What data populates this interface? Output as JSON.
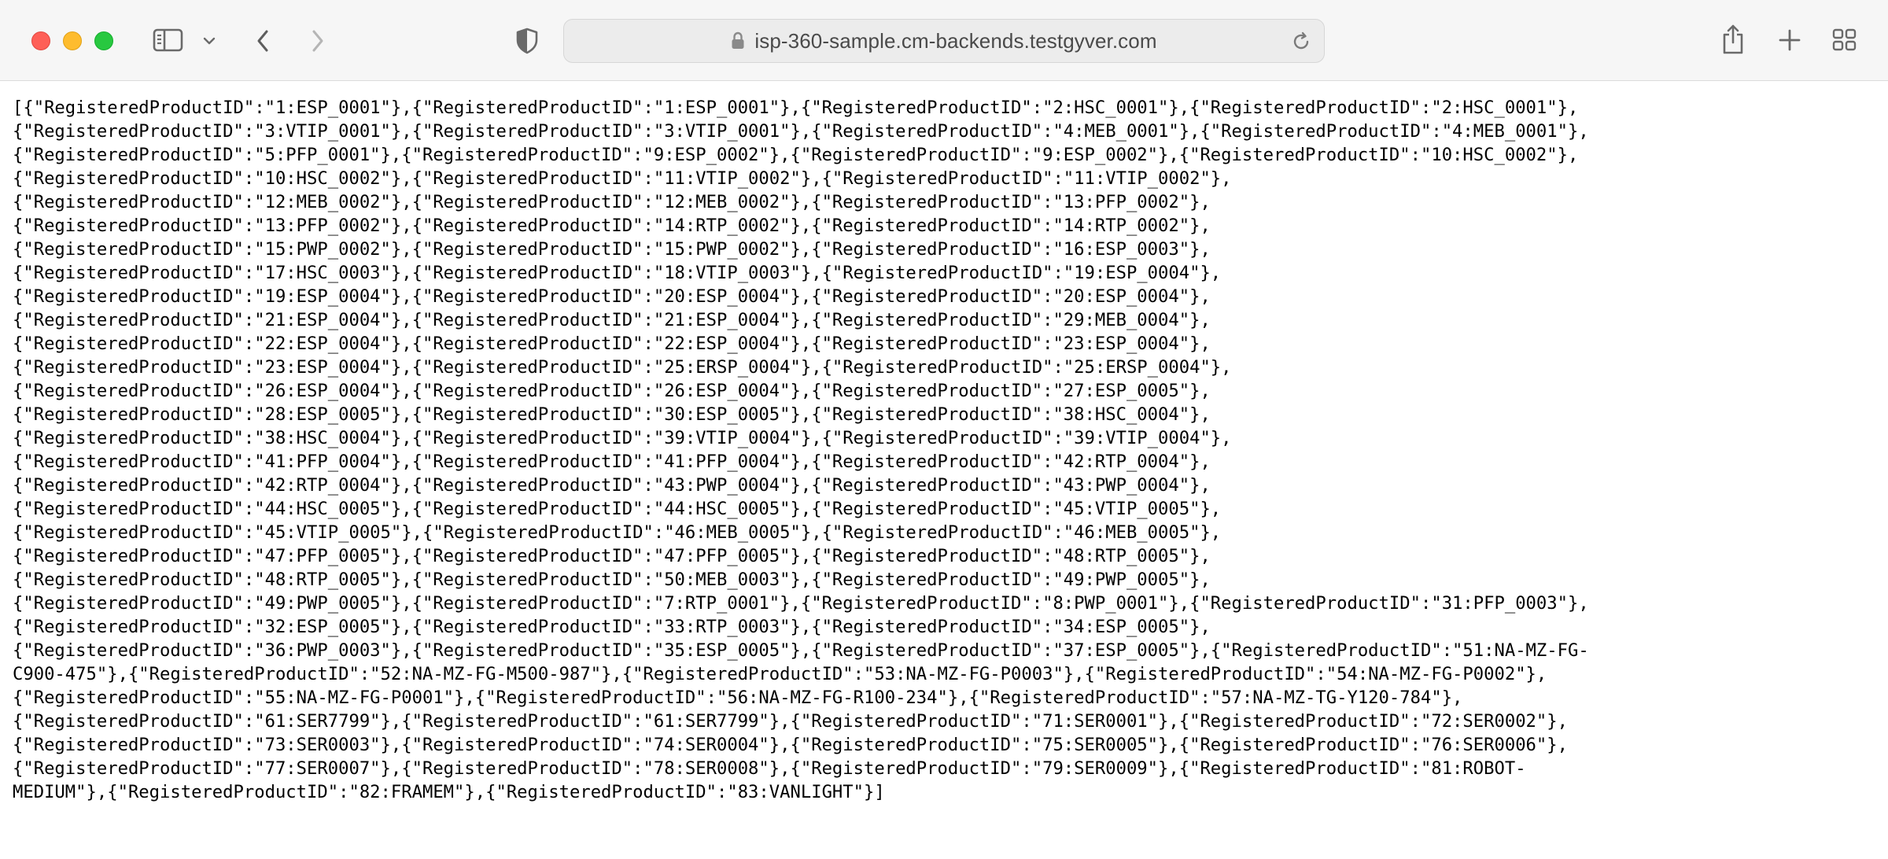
{
  "browser": {
    "url": "isp-360-sample.cm-backends.testgyver.com",
    "icons": {
      "close": "close-button",
      "minimize": "minimize-button",
      "maximize": "maximize-button",
      "sidebar": "sidebar-icon",
      "sidebar_menu": "chevron-down-icon",
      "back": "chevron-left-icon",
      "forward": "chevron-right-icon",
      "privacy": "shield-icon",
      "lock": "lock-icon",
      "reload": "reload-icon",
      "share": "share-icon",
      "new_tab": "plus-icon",
      "tab_overview": "grid-icon"
    },
    "colors": {
      "toolbar": "#f6f6f6",
      "close": "#fe5f57",
      "minimize": "#febc2e",
      "maximize": "#28c840"
    }
  },
  "page": {
    "lines": [
      "[{\"RegisteredProductID\":\"1:ESP_0001\"},{\"RegisteredProductID\":\"1:ESP_0001\"},{\"RegisteredProductID\":\"2:HSC_0001\"},{\"RegisteredProductID\":\"2:HSC_0001\"},",
      "{\"RegisteredProductID\":\"3:VTIP_0001\"},{\"RegisteredProductID\":\"3:VTIP_0001\"},{\"RegisteredProductID\":\"4:MEB_0001\"},{\"RegisteredProductID\":\"4:MEB_0001\"},",
      "{\"RegisteredProductID\":\"5:PFP_0001\"},{\"RegisteredProductID\":\"9:ESP_0002\"},{\"RegisteredProductID\":\"9:ESP_0002\"},{\"RegisteredProductID\":\"10:HSC_0002\"},",
      "{\"RegisteredProductID\":\"10:HSC_0002\"},{\"RegisteredProductID\":\"11:VTIP_0002\"},{\"RegisteredProductID\":\"11:VTIP_0002\"},",
      "{\"RegisteredProductID\":\"12:MEB_0002\"},{\"RegisteredProductID\":\"12:MEB_0002\"},{\"RegisteredProductID\":\"13:PFP_0002\"},",
      "{\"RegisteredProductID\":\"13:PFP_0002\"},{\"RegisteredProductID\":\"14:RTP_0002\"},{\"RegisteredProductID\":\"14:RTP_0002\"},",
      "{\"RegisteredProductID\":\"15:PWP_0002\"},{\"RegisteredProductID\":\"15:PWP_0002\"},{\"RegisteredProductID\":\"16:ESP_0003\"},",
      "{\"RegisteredProductID\":\"17:HSC_0003\"},{\"RegisteredProductID\":\"18:VTIP_0003\"},{\"RegisteredProductID\":\"19:ESP_0004\"},",
      "{\"RegisteredProductID\":\"19:ESP_0004\"},{\"RegisteredProductID\":\"20:ESP_0004\"},{\"RegisteredProductID\":\"20:ESP_0004\"},",
      "{\"RegisteredProductID\":\"21:ESP_0004\"},{\"RegisteredProductID\":\"21:ESP_0004\"},{\"RegisteredProductID\":\"29:MEB_0004\"},",
      "{\"RegisteredProductID\":\"22:ESP_0004\"},{\"RegisteredProductID\":\"22:ESP_0004\"},{\"RegisteredProductID\":\"23:ESP_0004\"},",
      "{\"RegisteredProductID\":\"23:ESP_0004\"},{\"RegisteredProductID\":\"25:ERSP_0004\"},{\"RegisteredProductID\":\"25:ERSP_0004\"},",
      "{\"RegisteredProductID\":\"26:ESP_0004\"},{\"RegisteredProductID\":\"26:ESP_0004\"},{\"RegisteredProductID\":\"27:ESP_0005\"},",
      "{\"RegisteredProductID\":\"28:ESP_0005\"},{\"RegisteredProductID\":\"30:ESP_0005\"},{\"RegisteredProductID\":\"38:HSC_0004\"},",
      "{\"RegisteredProductID\":\"38:HSC_0004\"},{\"RegisteredProductID\":\"39:VTIP_0004\"},{\"RegisteredProductID\":\"39:VTIP_0004\"},",
      "{\"RegisteredProductID\":\"41:PFP_0004\"},{\"RegisteredProductID\":\"41:PFP_0004\"},{\"RegisteredProductID\":\"42:RTP_0004\"},",
      "{\"RegisteredProductID\":\"42:RTP_0004\"},{\"RegisteredProductID\":\"43:PWP_0004\"},{\"RegisteredProductID\":\"43:PWP_0004\"},",
      "{\"RegisteredProductID\":\"44:HSC_0005\"},{\"RegisteredProductID\":\"44:HSC_0005\"},{\"RegisteredProductID\":\"45:VTIP_0005\"},",
      "{\"RegisteredProductID\":\"45:VTIP_0005\"},{\"RegisteredProductID\":\"46:MEB_0005\"},{\"RegisteredProductID\":\"46:MEB_0005\"},",
      "{\"RegisteredProductID\":\"47:PFP_0005\"},{\"RegisteredProductID\":\"47:PFP_0005\"},{\"RegisteredProductID\":\"48:RTP_0005\"},",
      "{\"RegisteredProductID\":\"48:RTP_0005\"},{\"RegisteredProductID\":\"50:MEB_0003\"},{\"RegisteredProductID\":\"49:PWP_0005\"},",
      "{\"RegisteredProductID\":\"49:PWP_0005\"},{\"RegisteredProductID\":\"7:RTP_0001\"},{\"RegisteredProductID\":\"8:PWP_0001\"},{\"RegisteredProductID\":\"31:PFP_0003\"},",
      "{\"RegisteredProductID\":\"32:ESP_0005\"},{\"RegisteredProductID\":\"33:RTP_0003\"},{\"RegisteredProductID\":\"34:ESP_0005\"},",
      "{\"RegisteredProductID\":\"36:PWP_0003\"},{\"RegisteredProductID\":\"35:ESP_0005\"},{\"RegisteredProductID\":\"37:ESP_0005\"},{\"RegisteredProductID\":\"51:NA-MZ-FG-",
      "C900-475\"},{\"RegisteredProductID\":\"52:NA-MZ-FG-M500-987\"},{\"RegisteredProductID\":\"53:NA-MZ-FG-P0003\"},{\"RegisteredProductID\":\"54:NA-MZ-FG-P0002\"},",
      "{\"RegisteredProductID\":\"55:NA-MZ-FG-P0001\"},{\"RegisteredProductID\":\"56:NA-MZ-FG-R100-234\"},{\"RegisteredProductID\":\"57:NA-MZ-TG-Y120-784\"},",
      "{\"RegisteredProductID\":\"61:SER7799\"},{\"RegisteredProductID\":\"61:SER7799\"},{\"RegisteredProductID\":\"71:SER0001\"},{\"RegisteredProductID\":\"72:SER0002\"},",
      "{\"RegisteredProductID\":\"73:SER0003\"},{\"RegisteredProductID\":\"74:SER0004\"},{\"RegisteredProductID\":\"75:SER0005\"},{\"RegisteredProductID\":\"76:SER0006\"},",
      "{\"RegisteredProductID\":\"77:SER0007\"},{\"RegisteredProductID\":\"78:SER0008\"},{\"RegisteredProductID\":\"79:SER0009\"},{\"RegisteredProductID\":\"81:ROBOT-",
      "MEDIUM\"},{\"RegisteredProductID\":\"82:FRAMEM\"},{\"RegisteredProductID\":\"83:VANLIGHT\"}]"
    ]
  }
}
